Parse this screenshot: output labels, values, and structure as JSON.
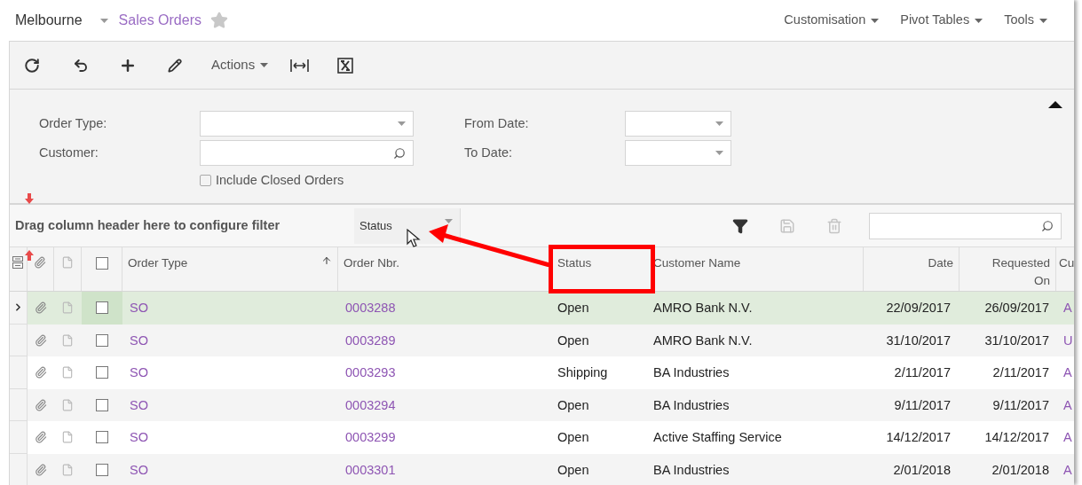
{
  "breadcrumb": {
    "company": "Melbourne",
    "screen": "Sales Orders",
    "favorite": false
  },
  "top_menu": [
    {
      "label": "Customisation"
    },
    {
      "label": "Pivot Tables"
    },
    {
      "label": "Tools"
    }
  ],
  "toolbar": {
    "actions_label": "Actions"
  },
  "filters": {
    "left": [
      {
        "label": "Order Type:",
        "kind": "select"
      },
      {
        "label": "Customer:",
        "kind": "lookup"
      }
    ],
    "right": [
      {
        "label": "From Date:",
        "kind": "select"
      },
      {
        "label": "To Date:",
        "kind": "select"
      }
    ],
    "include_closed": {
      "label": "Include Closed Orders",
      "checked": false
    },
    "expanded": true
  },
  "group_bar": {
    "hint": "Drag column header here to configure filter",
    "chips": [
      {
        "label": "Status"
      }
    ]
  },
  "table": {
    "select_all_checked": false,
    "columns": [
      {
        "label": "Order Type",
        "sorted": true
      },
      {
        "label": "Order Nbr.",
        "sorted": false
      },
      {
        "label": "Status",
        "sorted": false
      },
      {
        "label": "Customer Name",
        "sorted": false
      },
      {
        "label": "Date",
        "sorted": false
      },
      {
        "label": "Requested On",
        "sorted": false
      },
      {
        "label": "Cu"
      }
    ],
    "rows": [
      {
        "selected": true,
        "checked": false,
        "cells": [
          "SO",
          "0003288",
          "Open",
          "AMRO Bank N.V.",
          "22/09/2017",
          "26/09/2017",
          "A"
        ]
      },
      {
        "selected": false,
        "checked": false,
        "cells": [
          "SO",
          "0003289",
          "Open",
          "AMRO Bank N.V.",
          "31/10/2017",
          "31/10/2017",
          "U"
        ]
      },
      {
        "selected": false,
        "checked": false,
        "cells": [
          "SO",
          "0003293",
          "Shipping",
          "BA Industries",
          "2/11/2017",
          "2/11/2017",
          "A"
        ]
      },
      {
        "selected": false,
        "checked": false,
        "cells": [
          "SO",
          "0003294",
          "Open",
          "BA Industries",
          "9/11/2017",
          "9/11/2017",
          "A"
        ]
      },
      {
        "selected": false,
        "checked": false,
        "cells": [
          "SO",
          "0003299",
          "Open",
          "Active Staffing Service",
          "14/12/2017",
          "14/12/2017",
          "A"
        ]
      },
      {
        "selected": false,
        "checked": false,
        "cells": [
          "SO",
          "0003301",
          "Open",
          "BA Industries",
          "2/01/2018",
          "2/01/2018",
          "A"
        ]
      }
    ]
  }
}
